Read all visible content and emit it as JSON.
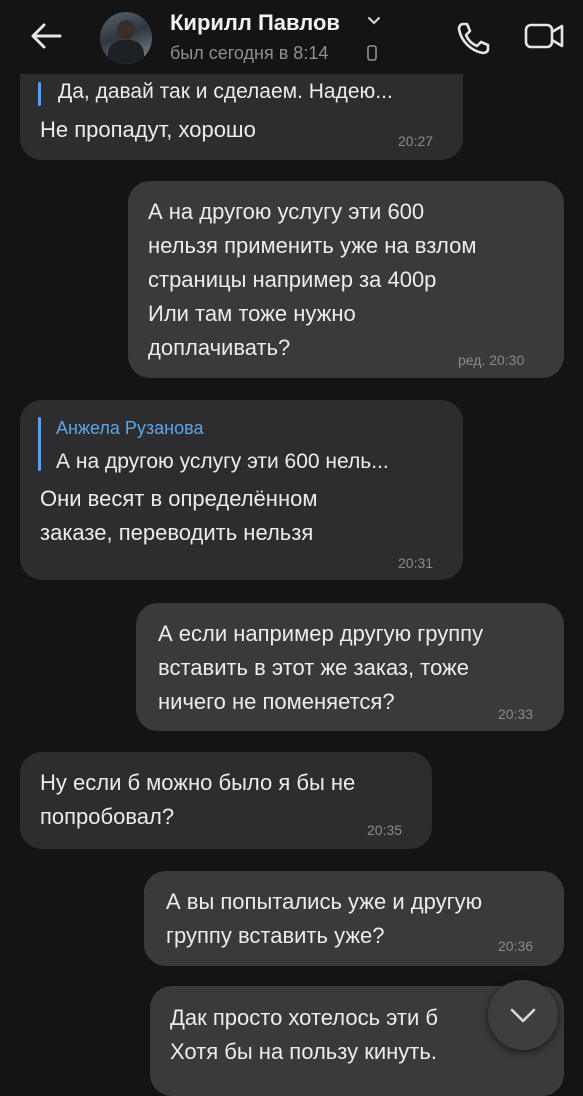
{
  "header": {
    "contact_name": "Кирилл Павлов",
    "status": "был сегодня в 8:14"
  },
  "messages": [
    {
      "direction": "in",
      "reply_text": "Да, давай так и сделаем. Надею...",
      "text": "Не пропадут, хорошо",
      "time": "20:27"
    },
    {
      "direction": "out",
      "text": "А на другою услугу эти 600\nнельзя применить уже на взлом\nстраницы например за 400р\nИли там тоже нужно\nдоплачивать?",
      "time": "ред. 20:30"
    },
    {
      "direction": "in",
      "reply_author": "Анжела Рузанова",
      "reply_text": "А на другою услугу эти 600 нель...",
      "text": "Они весят в определённом\nзаказе, переводить нельзя",
      "time": "20:31"
    },
    {
      "direction": "out",
      "text": "А если например другую группу\nвставить в этот же заказ, тоже\nничего не поменяется?",
      "time": "20:33"
    },
    {
      "direction": "in",
      "text": "Ну если б можно было я бы не\nпопробовал?",
      "time": "20:35"
    },
    {
      "direction": "out",
      "text": "А вы попытались уже и другую\nгруппу вставить уже?",
      "time": "20:36"
    },
    {
      "direction": "out",
      "text": "Дак просто хотелось эти б\nХотя бы на пользу кинуть.",
      "time": ""
    }
  ]
}
